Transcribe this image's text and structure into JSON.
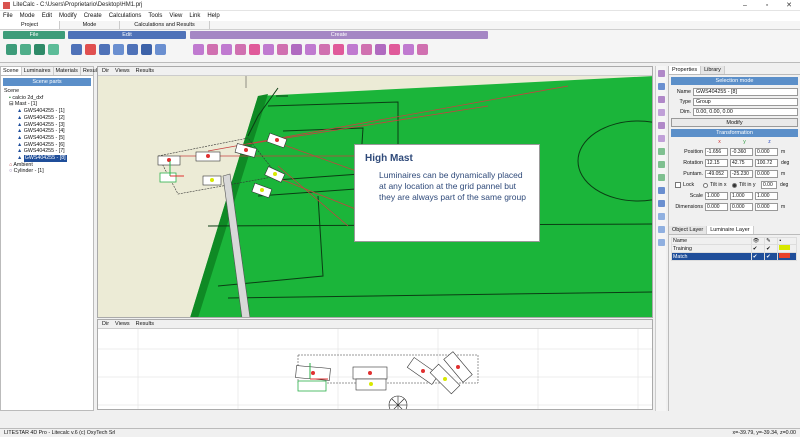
{
  "window": {
    "title": "LiteCalc - C:\\Users\\Proprietario\\Desktop\\HM1.prj",
    "minimize": "–",
    "maximize": "▫",
    "close": "✕"
  },
  "menu": [
    "File",
    "Mode",
    "Edit",
    "Modify",
    "Create",
    "Calculations",
    "Tools",
    "View",
    "Link",
    "Help"
  ],
  "ribbon_tabs": [
    "Project",
    "Mode",
    "Calculations and Results"
  ],
  "ribbon_groups": {
    "file": "File",
    "edit": "Edit",
    "create": "Create"
  },
  "colors": {
    "file_group": "#3d9c7a",
    "edit_group": "#4f72b8",
    "create_group": "#a587c4",
    "field": "#1bb53a",
    "field_dark": "#0f8a25",
    "selection": "#1f4e9a",
    "panel_header": "#5b8fc9",
    "popup_text": "#2f4a7a",
    "training_swatch": "#d8e800",
    "match_swatch": "#e8412a"
  },
  "left_panel": {
    "tabs": [
      "Scene",
      "Luminaires",
      "Materials",
      "Results"
    ],
    "header": "Scene parts",
    "tree": [
      {
        "label": "Scene",
        "indent": 0
      },
      {
        "label": "calcio 2d_dxf",
        "indent": 1
      },
      {
        "label": "Mast - [1]",
        "indent": 1
      },
      {
        "label": "GWS404255 - [1]",
        "indent": 2
      },
      {
        "label": "GWS404255 - [2]",
        "indent": 2
      },
      {
        "label": "GWS404255 - [3]",
        "indent": 2
      },
      {
        "label": "GWS404255 - [4]",
        "indent": 2
      },
      {
        "label": "GWS404255 - [5]",
        "indent": 2
      },
      {
        "label": "GWS404255 - [6]",
        "indent": 2
      },
      {
        "label": "GWS404255 - [7]",
        "indent": 2
      },
      {
        "label": "GWS404255 - [8]",
        "indent": 2,
        "selected": true
      },
      {
        "label": "Ambient",
        "indent": 0
      },
      {
        "label": "Cylinder - [1]",
        "indent": 0
      }
    ]
  },
  "view3d": {
    "menu": [
      "Dir",
      "Views",
      "Results"
    ]
  },
  "view2d": {
    "menu": [
      "Dir",
      "Views",
      "Results"
    ]
  },
  "popup": {
    "title": "High Mast",
    "body": "Luminaires can be dynamically placed at any location at the grid pannel but they are always part of the same group"
  },
  "properties": {
    "tabs": [
      "Properties",
      "Library"
    ],
    "header": "Selection mode",
    "name_label": "Name",
    "name_value": "GWS404255 - [8]",
    "type_label": "Type",
    "type_value": "Group",
    "dim_label": "Dim.",
    "dim_value": "0.00, 0.00, 0.00",
    "modify_button": "Modify",
    "transform_header": "Transformation",
    "axes": [
      "x",
      "y",
      "z"
    ],
    "rows": [
      {
        "label": "Position",
        "values": [
          "-1.656",
          "-0.360",
          "0.000"
        ],
        "unit": "m"
      },
      {
        "label": "Rotation",
        "values": [
          "12.15",
          "42.75",
          "100.72"
        ],
        "unit": "deg"
      },
      {
        "label": "Puntam.",
        "values": [
          "-49.052",
          "-25.230",
          "0.000"
        ],
        "unit": "m"
      }
    ],
    "lock_label": "Lock",
    "tilt_x_label": "Tilt in x",
    "tilt_y_label": "Tilt in y",
    "tilt_value": "0.00",
    "tilt_unit": "deg",
    "scale_label": "Scale",
    "scale_values": [
      "1.000",
      "1.000",
      "1.000"
    ],
    "dim_label2": "Dimensions",
    "dim_values": [
      "0.000",
      "0.000",
      "0.000"
    ],
    "dim_unit": "m"
  },
  "layers": {
    "tabs": [
      "Object Layer",
      "Luminaire Layer"
    ],
    "col_name": "Name",
    "rows": [
      {
        "name": "Training",
        "selected": false
      },
      {
        "name": "Match",
        "selected": true
      }
    ]
  },
  "status": {
    "left": "LITESTAR 4D Pro - Litecalc v.6   (c) OxyTech Srl",
    "right": "x=-39.79, y=-39.34, z=0.00"
  }
}
